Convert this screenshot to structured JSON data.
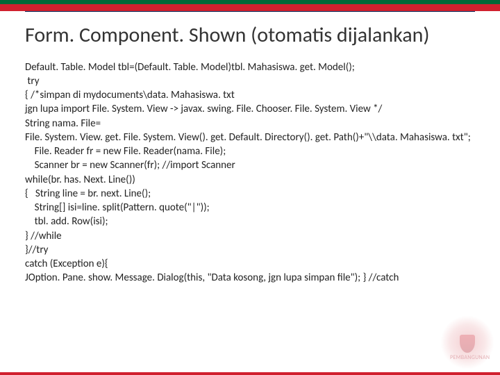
{
  "heading": "Form. Component. Shown (otomatis dijalankan)",
  "code_lines": [
    "Default. Table. Model tbl=(Default. Table. Model)tbl. Mahasiswa. get. Model();",
    " try",
    "{ /*simpan di mydocuments\\data. Mahasiswa. txt",
    "jgn lupa import File. System. View -> javax. swing. File. Chooser. File. System. View */",
    "String nama. File=",
    "File. System. View. get. File. System. View(). get. Default. Directory(). get. Path()+\"\\\\data. Mahasiswa. txt\";",
    "    File. Reader fr = new File. Reader(nama. File);",
    "    Scanner br = new Scanner(fr); //import Scanner",
    "while(br. has. Next. Line())",
    "{   String line = br. next. Line();",
    "    String[] isi=line. split(Pattern. quote(\"|\"));",
    "    tbl. add. Row(isi);",
    "} //while",
    "}//try",
    "catch (Exception e){",
    "JOption. Pane. show. Message. Dialog(this, \"Data kosong, jgn lupa simpan file\"); } //catch"
  ],
  "watermark_label": "PEMBANGUNAN"
}
